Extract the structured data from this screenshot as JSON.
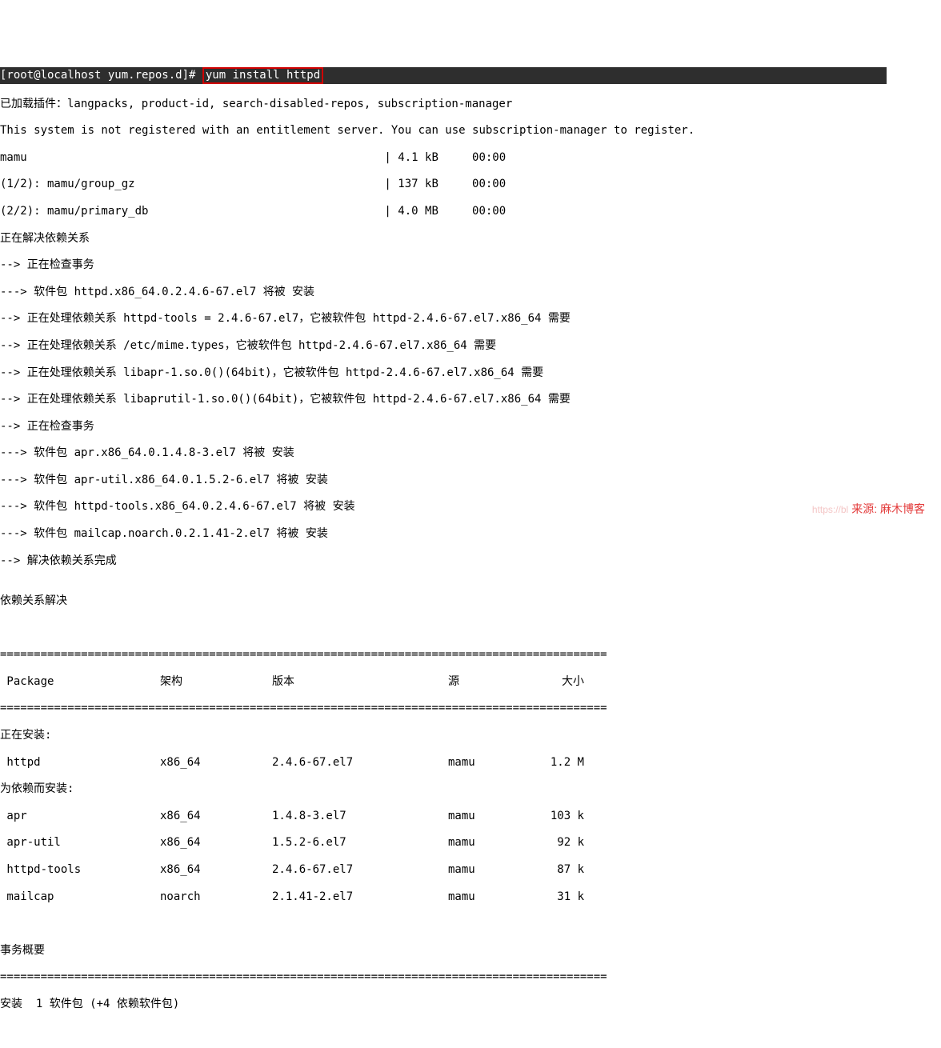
{
  "prompt": {
    "prefix": "[root@localhost yum.repos.d]# ",
    "command": "yum install httpd"
  },
  "lines": [
    "已加载插件：langpacks, product-id, search-disabled-repos, subscription-manager",
    "This system is not registered with an entitlement server. You can use subscription-manager to register.",
    "mamu                                                     | 4.1 kB     00:00",
    "(1/2): mamu/group_gz                                     | 137 kB     00:00",
    "(2/2): mamu/primary_db                                   | 4.0 MB     00:00",
    "正在解决依赖关系",
    "--> 正在检查事务",
    "---> 软件包 httpd.x86_64.0.2.4.6-67.el7 将被 安装",
    "--> 正在处理依赖关系 httpd-tools = 2.4.6-67.el7，它被软件包 httpd-2.4.6-67.el7.x86_64 需要",
    "--> 正在处理依赖关系 /etc/mime.types，它被软件包 httpd-2.4.6-67.el7.x86_64 需要",
    "--> 正在处理依赖关系 libapr-1.so.0()(64bit)，它被软件包 httpd-2.4.6-67.el7.x86_64 需要",
    "--> 正在处理依赖关系 libaprutil-1.so.0()(64bit)，它被软件包 httpd-2.4.6-67.el7.x86_64 需要",
    "--> 正在检查事务",
    "---> 软件包 apr.x86_64.0.1.4.8-3.el7 将被 安装",
    "---> 软件包 apr-util.x86_64.0.1.5.2-6.el7 将被 安装",
    "---> 软件包 httpd-tools.x86_64.0.2.4.6-67.el7 将被 安装",
    "---> 软件包 mailcap.noarch.0.2.1.41-2.el7 将被 安装",
    "--> 解决依赖关系完成",
    "",
    "依赖关系解决"
  ],
  "headers": {
    "pkg": " Package",
    "arch": "架构",
    "ver": "版本",
    "repo": "源",
    "size": "大小"
  },
  "section_install": "正在安装:",
  "section_deps": "为依赖而安装:",
  "rows_install": [
    {
      "pkg": " httpd",
      "arch": "x86_64",
      "ver": "2.4.6-67.el7",
      "repo": "mamu",
      "size": "1.2 M"
    }
  ],
  "rows_deps": [
    {
      "pkg": " apr",
      "arch": "x86_64",
      "ver": "1.4.8-3.el7",
      "repo": "mamu",
      "size": "103 k"
    },
    {
      "pkg": " apr-util",
      "arch": "x86_64",
      "ver": "1.5.2-6.el7",
      "repo": "mamu",
      "size": "92 k"
    },
    {
      "pkg": " httpd-tools",
      "arch": "x86_64",
      "ver": "2.4.6-67.el7",
      "repo": "mamu",
      "size": "87 k"
    },
    {
      "pkg": " mailcap",
      "arch": "noarch",
      "ver": "2.1.41-2.el7",
      "repo": "mamu",
      "size": "31 k"
    }
  ],
  "summary_label": "事务概要",
  "install_summary": "安装  1 软件包 (+4 依赖软件包)",
  "hr_double": "==========================================================================================",
  "hr_single": "",
  "watermark": {
    "faint": "https://bl",
    "main": "来源: 麻木博客"
  }
}
